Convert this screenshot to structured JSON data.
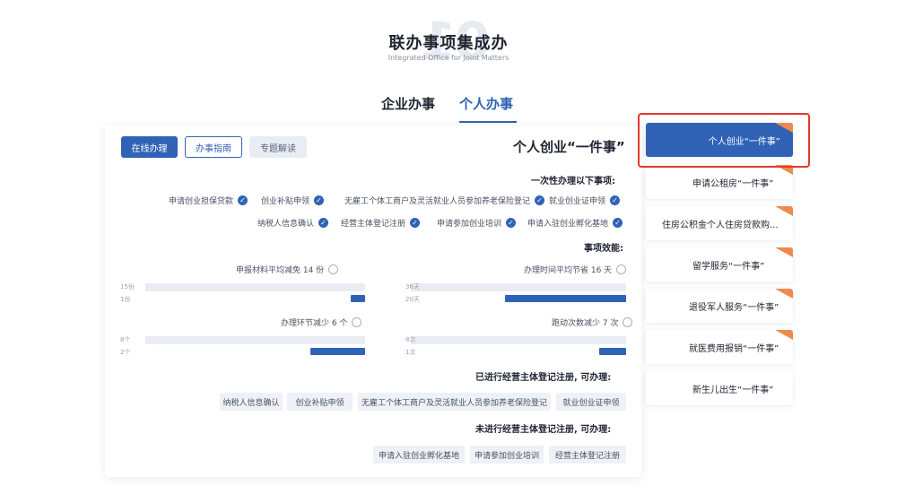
{
  "header": {
    "watermark": "01",
    "title": "联办事项集成办",
    "subtitle": "Integrated Office for Joint Matters"
  },
  "tabs": [
    {
      "label": "企业办事",
      "active": false
    },
    {
      "label": "个人办事",
      "active": true
    }
  ],
  "card": {
    "title": "个人创业“一件事”",
    "buttons": {
      "online": "在线办理",
      "guide": "办事指南",
      "special": "专题解读"
    },
    "once_title": "一次性办理以下事项:",
    "once_items_row1": [
      "就业创业证申领",
      "无雇工个体工商户及灵活就业人员参加养老保险登记",
      "创业补贴申领",
      "申请创业担保贷款"
    ],
    "once_items_row2": [
      "申请入驻创业孵化基地",
      "申请参加创业培训",
      "经营主体登记注册",
      "纳税人信息确认"
    ],
    "effect_title": "事项效能:",
    "metrics": [
      {
        "label": "办理时间平均节省 16 天",
        "before_label": "36天",
        "after_label": "20天",
        "before": 36,
        "after": 20
      },
      {
        "label": "申报材料平均减免 14 份",
        "before_label": "15份",
        "after_label": "1份",
        "before": 15,
        "after": 1
      },
      {
        "label": "跑动次数减少 7 次",
        "before_label": "8次",
        "after_label": "1次",
        "before": 8,
        "after": 1
      },
      {
        "label": "办理环节减少 6 个",
        "before_label": "8个",
        "after_label": "2个",
        "before": 8,
        "after": 2
      }
    ],
    "registered_title": "已进行经营主体登记注册, 可办理:",
    "registered_tags": [
      "就业创业证申领",
      "无雇工个体工商户及灵活就业人员参加养老保险登记",
      "创业补贴申领",
      "纳税人信息确认"
    ],
    "unregistered_title": "未进行经营主体登记注册, 可办理:",
    "unregistered_tags": [
      "经营主体登记注册",
      "申请参加创业培训",
      "申请入驻创业孵化基地"
    ]
  },
  "sidebar": {
    "items": [
      {
        "label": "个人创业“一件事”",
        "active": true,
        "hot": true
      },
      {
        "label": "申请公租房“一件事”",
        "active": false,
        "hot": true
      },
      {
        "label": "住房公积金个人住房贷款购...",
        "active": false,
        "hot": true
      },
      {
        "label": "留学服务“一件事”",
        "active": false,
        "hot": true
      },
      {
        "label": "退役军人服务“一件事”",
        "active": false,
        "hot": true
      },
      {
        "label": "就医费用报销“一件事”",
        "active": false,
        "hot": true
      },
      {
        "label": "新生儿出生“一件事”",
        "active": false,
        "hot": false
      }
    ]
  },
  "colors": {
    "accent": "#3063b5",
    "highlight": "#e23a2e",
    "hot_badge": "#f08a4b"
  }
}
